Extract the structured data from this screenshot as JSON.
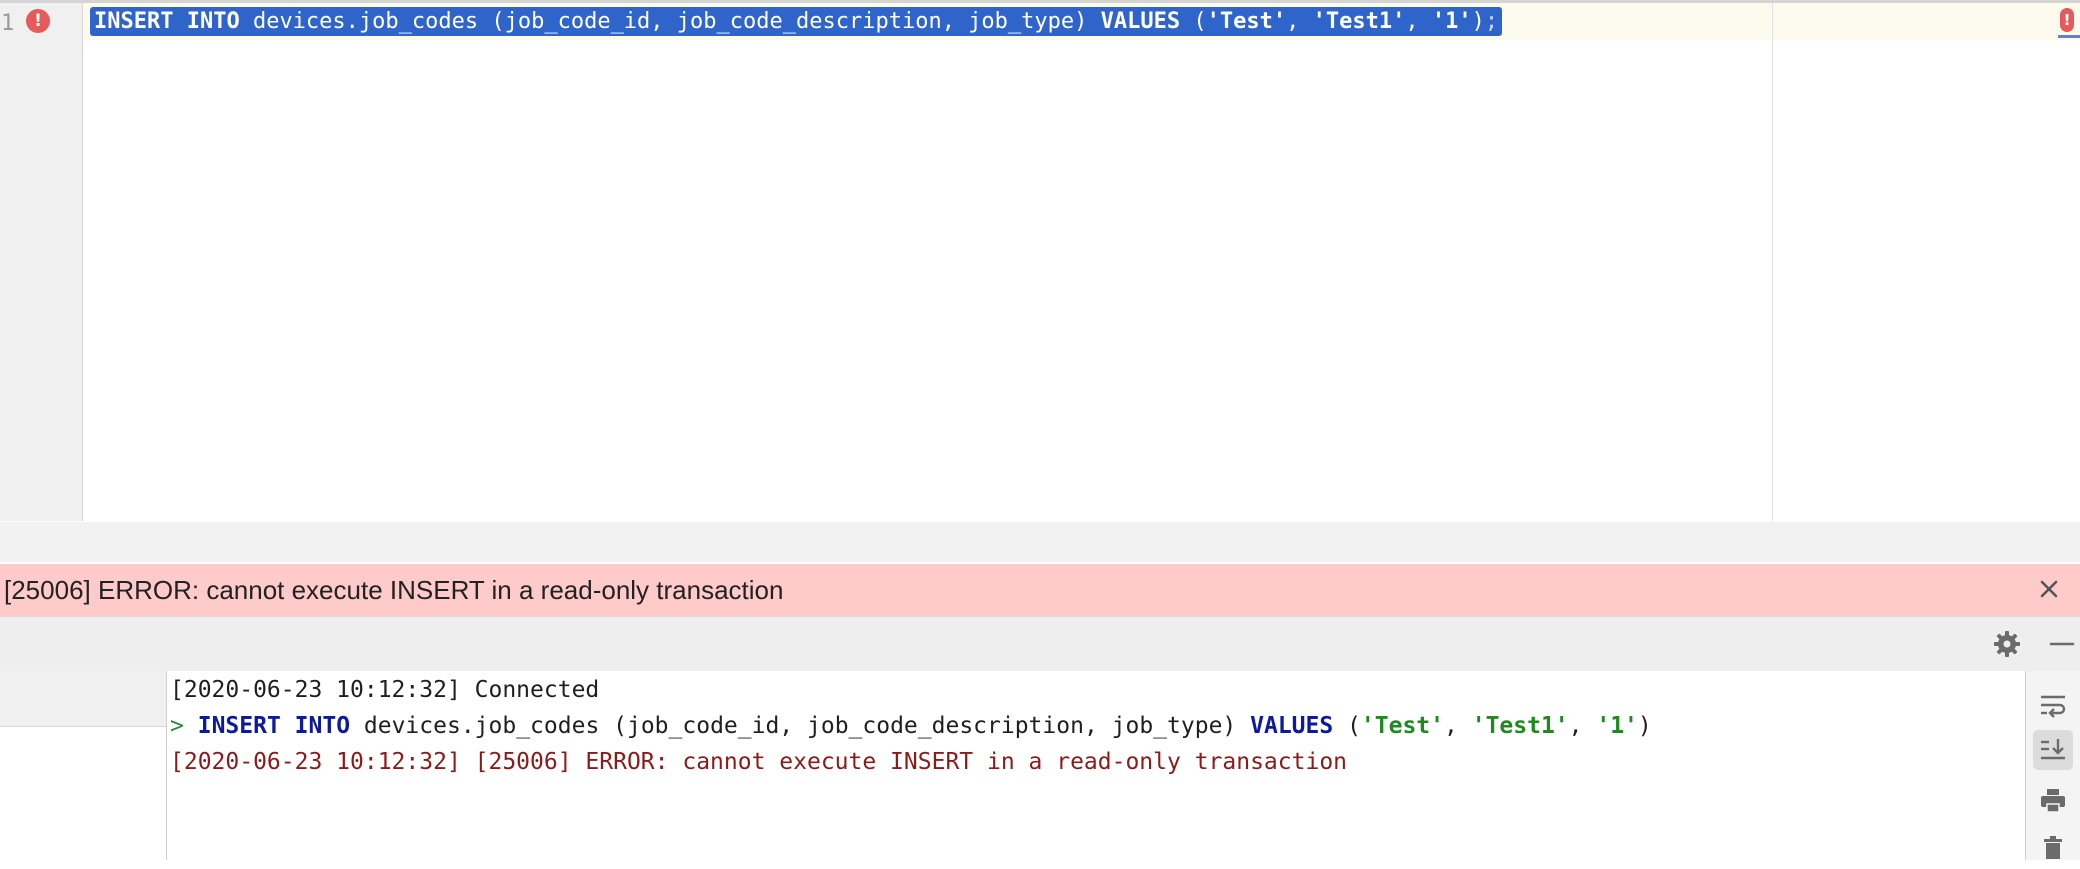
{
  "editor": {
    "line_number": "1",
    "gutter_error_symbol": "!",
    "code": {
      "kw_insert_into": "INSERT INTO",
      "table_and_cols": " devices.job_codes (job_code_id, job_code_description, job_type) ",
      "kw_values": "VALUES",
      "open": " (",
      "val1": "'Test'",
      "sep1": ", ",
      "val2": "'Test1'",
      "sep2": ", ",
      "val3": "'1'",
      "close": ")",
      "semicolon": ";"
    },
    "scroll_error_symbol": "!"
  },
  "error_banner": {
    "message": "[25006] ERROR: cannot execute INSERT in a read-only transaction"
  },
  "console": {
    "line1": "[2020-06-23 10:12:32] Connected",
    "line2": {
      "prompt": ">",
      "kw_insert_into": "INSERT INTO",
      "table_and_cols": " devices.job_codes (job_code_id, job_code_description, job_type) ",
      "kw_values": "VALUES",
      "open": " (",
      "val1": "'Test'",
      "sep1": ", ",
      "val2": "'Test1'",
      "sep2": ", ",
      "val3": "'1'",
      "close": ")"
    },
    "line3": "[2020-06-23 10:12:32] [25006] ERROR: cannot execute INSERT in a read-only transaction"
  },
  "icons": {
    "close": "close-icon",
    "settings": "gear-icon",
    "minimize": "minimize-icon",
    "soft_wrap": "soft-wrap-icon",
    "scroll_to_end": "scroll-to-end-icon",
    "print": "print-icon",
    "clear": "trash-icon"
  },
  "colors": {
    "selection": "#2f65ca",
    "error_banner_bg": "#ffcaca",
    "error_text": "#8b1a1a",
    "keyword": "#0d1a9e",
    "string": "#1f8a1f",
    "error_marker": "#e55b5b"
  }
}
